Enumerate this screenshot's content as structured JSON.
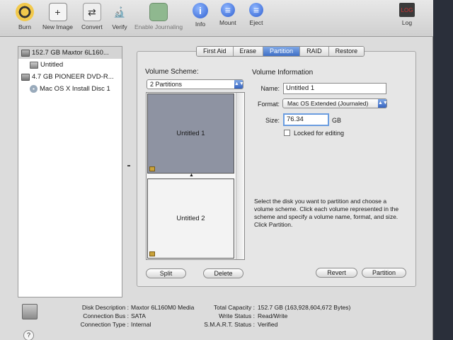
{
  "toolbar": {
    "burn": "Burn",
    "new_image": "New Image",
    "convert": "Convert",
    "verify": "Verify",
    "enable_journaling": "Enable Journaling",
    "info": "Info",
    "info_glyph": "i",
    "mount": "Mount",
    "eject": "Eject",
    "log": "Log",
    "log_badge": "LOG"
  },
  "sidebar": {
    "items": [
      {
        "label": "152.7 GB Maxtor 6L160..."
      },
      {
        "label": "Untitled"
      },
      {
        "label": "4.7 GB PIONEER DVD-R..."
      },
      {
        "label": "Mac OS X Install Disc 1"
      }
    ]
  },
  "tabs": [
    "First Aid",
    "Erase",
    "Partition",
    "RAID",
    "Restore"
  ],
  "scheme": {
    "label": "Volume Scheme:",
    "selected": "2 Partitions",
    "volumes": [
      "Untitled 1",
      "Untitled 2"
    ]
  },
  "info": {
    "heading": "Volume Information",
    "name_label": "Name:",
    "name_value": "Untitled 1",
    "format_label": "Format:",
    "format_value": "Mac OS Extended (Journaled)",
    "size_label": "Size:",
    "size_value": "76.34",
    "size_unit": "GB",
    "locked_label": "Locked for editing"
  },
  "description": "Select the disk you want to partition and choose a volume scheme. Click each volume represented in the scheme and specify a volume name, format, and size. Click Partition.",
  "buttons": {
    "split": "Split",
    "delete": "Delete",
    "revert": "Revert",
    "partition": "Partition"
  },
  "footer": {
    "disk_description_label": "Disk Description :",
    "disk_description": "Maxtor 6L160M0 Media",
    "connection_bus_label": "Connection Bus :",
    "connection_bus": "SATA",
    "connection_type_label": "Connection Type :",
    "connection_type": "Internal",
    "total_capacity_label": "Total Capacity :",
    "total_capacity": "152.7 GB (163,928,604,672 Bytes)",
    "write_status_label": "Write Status :",
    "write_status": "Read/Write",
    "smart_status_label": "S.M.A.R.T. Status :",
    "smart_status": "Verified",
    "help": "?"
  },
  "colors": {
    "accent": "#3f6fc6",
    "selected_volume": "#8e93a2"
  }
}
